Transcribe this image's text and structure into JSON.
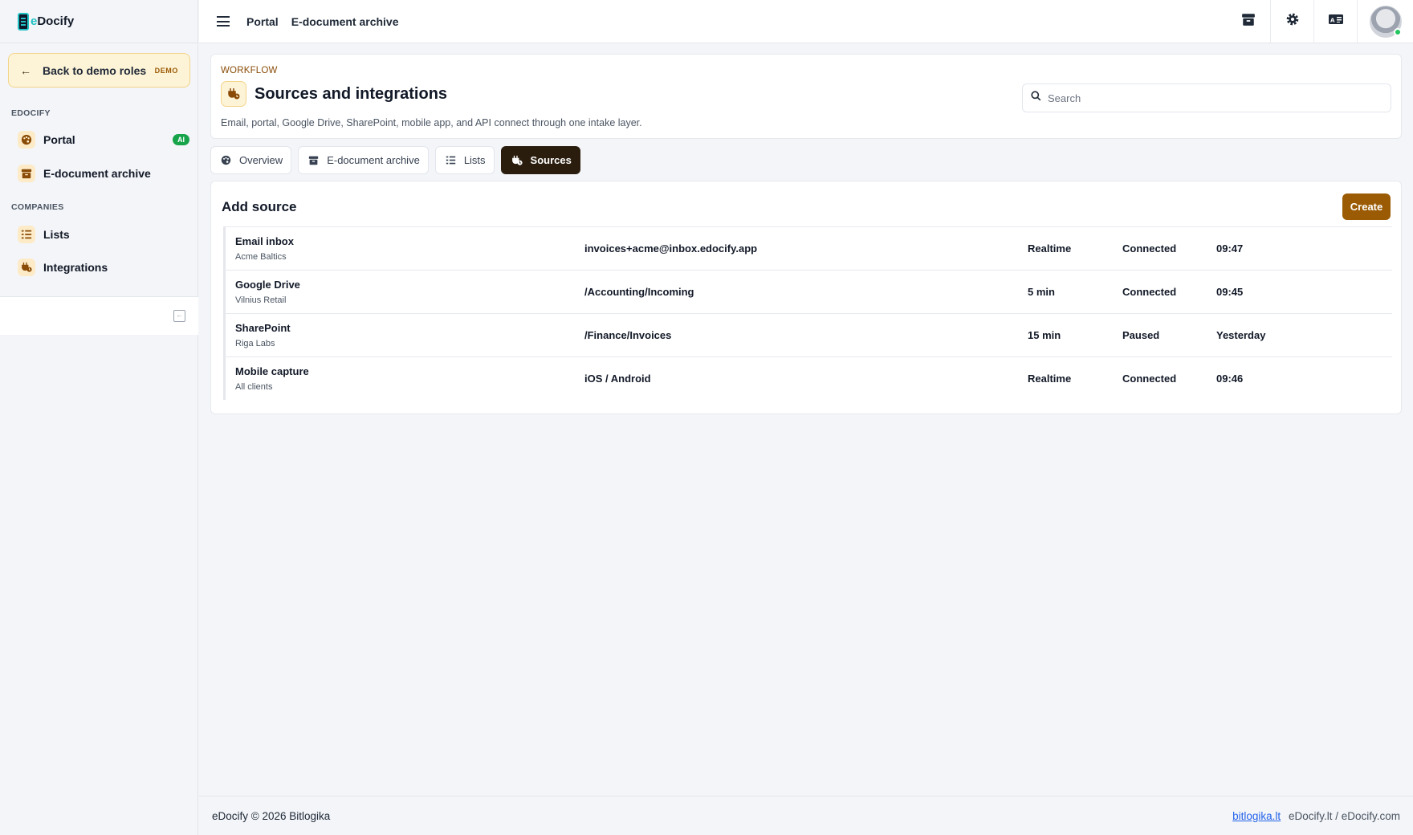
{
  "brand": {
    "prefix": "e",
    "name": "Docify"
  },
  "sidebar": {
    "back_label": "Back to demo roles",
    "demo_badge": "DEMO",
    "sections": [
      {
        "title": "EDOCIFY",
        "items": [
          {
            "label": "Portal",
            "badge": "AI",
            "icon": "palette-icon"
          },
          {
            "label": "E-document archive",
            "icon": "archive-icon"
          }
        ]
      },
      {
        "title": "COMPANIES",
        "items": [
          {
            "label": "Lists",
            "icon": "list-icon"
          },
          {
            "label": "Integrations",
            "icon": "plug-icon"
          }
        ]
      }
    ]
  },
  "topbar": {
    "breadcrumbs": [
      "Portal",
      "E-document archive"
    ],
    "icons": [
      "archive-icon",
      "gear-icon",
      "id-card-icon"
    ]
  },
  "header": {
    "eyebrow": "WORKFLOW",
    "title": "Sources and integrations",
    "subtitle": "Email, portal, Google Drive, SharePoint, mobile app, and API connect through one intake layer.",
    "search_placeholder": "Search"
  },
  "tabs": [
    {
      "label": "Overview",
      "icon": "palette-icon",
      "active": false
    },
    {
      "label": "E-document archive",
      "icon": "archive-icon",
      "active": false
    },
    {
      "label": "Lists",
      "icon": "list-icon",
      "active": false
    },
    {
      "label": "Sources",
      "icon": "plug-icon",
      "active": true
    }
  ],
  "sources": {
    "title": "Add source",
    "create_label": "Create",
    "rows": [
      {
        "name": "Email inbox",
        "client": "Acme Baltics",
        "target": "invoices+acme@inbox.edocify.app",
        "sync": "Realtime",
        "status": "Connected",
        "time": "09:47"
      },
      {
        "name": "Google Drive",
        "client": "Vilnius Retail",
        "target": "/Accounting/Incoming",
        "sync": "5 min",
        "status": "Connected",
        "time": "09:45"
      },
      {
        "name": "SharePoint",
        "client": "Riga Labs",
        "target": "/Finance/Invoices",
        "sync": "15 min",
        "status": "Paused",
        "time": "Yesterday"
      },
      {
        "name": "Mobile capture",
        "client": "All clients",
        "target": "iOS / Android",
        "sync": "Realtime",
        "status": "Connected",
        "time": "09:46"
      }
    ]
  },
  "footer": {
    "left": "eDocify © 2026 Bitlogika",
    "link": "bitlogika.lt",
    "right": "eDocify.lt / eDocify.com"
  },
  "colors": {
    "accent": "#9a5b04",
    "active_tab": "#2a1d0e",
    "ai_badge": "#16a34a",
    "logo": "#22c1c3"
  }
}
